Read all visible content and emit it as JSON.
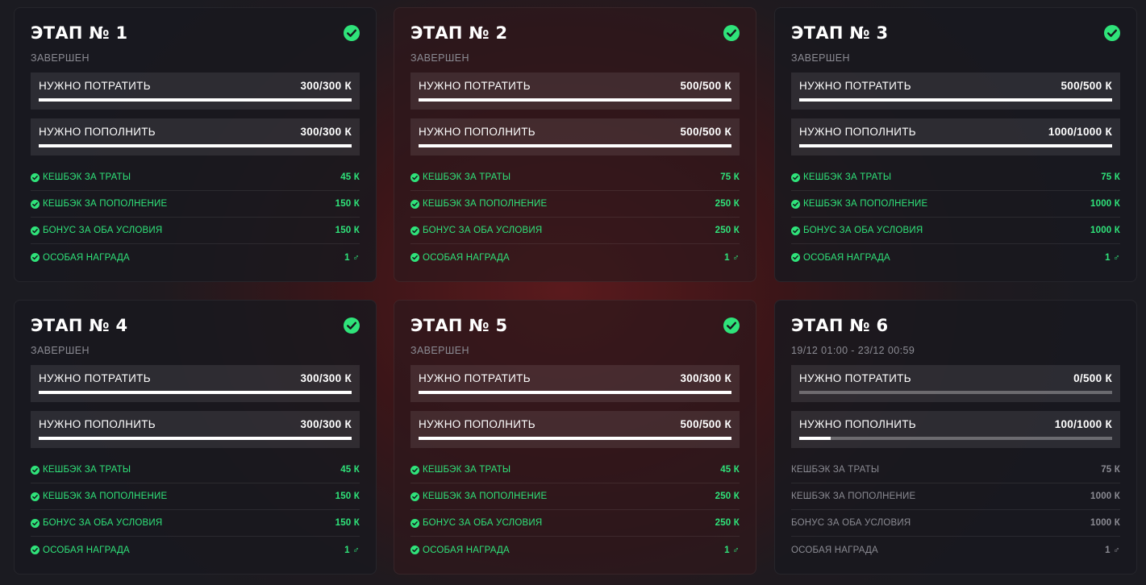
{
  "stages": [
    {
      "title": "ЭТАП № 1",
      "subtitle": "ЗАВЕРШЕН",
      "completed": true,
      "requirements": [
        {
          "label": "НУЖНО ПОТРАТИТЬ",
          "value": "300/300 К",
          "progress": 1.0
        },
        {
          "label": "НУЖНО ПОПОЛНИТЬ",
          "value": "300/300 К",
          "progress": 1.0
        }
      ],
      "rewards": [
        {
          "label": "КЕШБЭК ЗА ТРАТЫ",
          "value": "45 К"
        },
        {
          "label": "КЕШБЭК ЗА ПОПОЛНЕНИЕ",
          "value": "150 К"
        },
        {
          "label": "БОНУС ЗА ОБА УСЛОВИЯ",
          "value": "150 К"
        },
        {
          "label": "ОСОБАЯ НАГРАДА",
          "value": "1 ♂"
        }
      ]
    },
    {
      "title": "ЭТАП № 2",
      "subtitle": "ЗАВЕРШЕН",
      "completed": true,
      "requirements": [
        {
          "label": "НУЖНО ПОТРАТИТЬ",
          "value": "500/500 К",
          "progress": 1.0
        },
        {
          "label": "НУЖНО ПОПОЛНИТЬ",
          "value": "500/500 К",
          "progress": 1.0
        }
      ],
      "rewards": [
        {
          "label": "КЕШБЭК ЗА ТРАТЫ",
          "value": "75 К"
        },
        {
          "label": "КЕШБЭК ЗА ПОПОЛНЕНИЕ",
          "value": "250 К"
        },
        {
          "label": "БОНУС ЗА ОБА УСЛОВИЯ",
          "value": "250 К"
        },
        {
          "label": "ОСОБАЯ НАГРАДА",
          "value": "1 ♂"
        }
      ]
    },
    {
      "title": "ЭТАП № 3",
      "subtitle": "ЗАВЕРШЕН",
      "completed": true,
      "requirements": [
        {
          "label": "НУЖНО ПОТРАТИТЬ",
          "value": "500/500 К",
          "progress": 1.0
        },
        {
          "label": "НУЖНО ПОПОЛНИТЬ",
          "value": "1000/1000 К",
          "progress": 1.0
        }
      ],
      "rewards": [
        {
          "label": "КЕШБЭК ЗА ТРАТЫ",
          "value": "75 К"
        },
        {
          "label": "КЕШБЭК ЗА ПОПОЛНЕНИЕ",
          "value": "1000 К"
        },
        {
          "label": "БОНУС ЗА ОБА УСЛОВИЯ",
          "value": "1000 К"
        },
        {
          "label": "ОСОБАЯ НАГРАДА",
          "value": "1 ♂"
        }
      ]
    },
    {
      "title": "ЭТАП № 4",
      "subtitle": "ЗАВЕРШЕН",
      "completed": true,
      "requirements": [
        {
          "label": "НУЖНО ПОТРАТИТЬ",
          "value": "300/300 К",
          "progress": 1.0
        },
        {
          "label": "НУЖНО ПОПОЛНИТЬ",
          "value": "300/300 К",
          "progress": 1.0
        }
      ],
      "rewards": [
        {
          "label": "КЕШБЭК ЗА ТРАТЫ",
          "value": "45 К"
        },
        {
          "label": "КЕШБЭК ЗА ПОПОЛНЕНИЕ",
          "value": "150 К"
        },
        {
          "label": "БОНУС ЗА ОБА УСЛОВИЯ",
          "value": "150 К"
        },
        {
          "label": "ОСОБАЯ НАГРАДА",
          "value": "1 ♂"
        }
      ]
    },
    {
      "title": "ЭТАП № 5",
      "subtitle": "ЗАВЕРШЕН",
      "completed": true,
      "requirements": [
        {
          "label": "НУЖНО ПОТРАТИТЬ",
          "value": "300/300 К",
          "progress": 1.0
        },
        {
          "label": "НУЖНО ПОПОЛНИТЬ",
          "value": "500/500 К",
          "progress": 1.0
        }
      ],
      "rewards": [
        {
          "label": "КЕШБЭК ЗА ТРАТЫ",
          "value": "45 К"
        },
        {
          "label": "КЕШБЭК ЗА ПОПОЛНЕНИЕ",
          "value": "250 К"
        },
        {
          "label": "БОНУС ЗА ОБА УСЛОВИЯ",
          "value": "250 К"
        },
        {
          "label": "ОСОБАЯ НАГРАДА",
          "value": "1 ♂"
        }
      ]
    },
    {
      "title": "ЭТАП № 6",
      "subtitle": "19/12 01:00 - 23/12 00:59",
      "completed": false,
      "requirements": [
        {
          "label": "НУЖНО ПОТРАТИТЬ",
          "value": "0/500 К",
          "progress": 0.0
        },
        {
          "label": "НУЖНО ПОПОЛНИТЬ",
          "value": "100/1000 К",
          "progress": 0.1
        }
      ],
      "rewards": [
        {
          "label": "КЕШБЭК ЗА ТРАТЫ",
          "value": "75 К"
        },
        {
          "label": "КЕШБЭК ЗА ПОПОЛНЕНИЕ",
          "value": "1000 К"
        },
        {
          "label": "БОНУС ЗА ОБА УСЛОВИЯ",
          "value": "1000 К"
        },
        {
          "label": "ОСОБАЯ НАГРАДА",
          "value": "1 ♂"
        }
      ]
    }
  ],
  "colors": {
    "accent_green": "#2fe37a",
    "muted_text": "#8b8b93",
    "background_red": "#5a1a1d"
  },
  "icons": {
    "completed": "check-circle-icon",
    "reward": "check-circle-icon"
  }
}
